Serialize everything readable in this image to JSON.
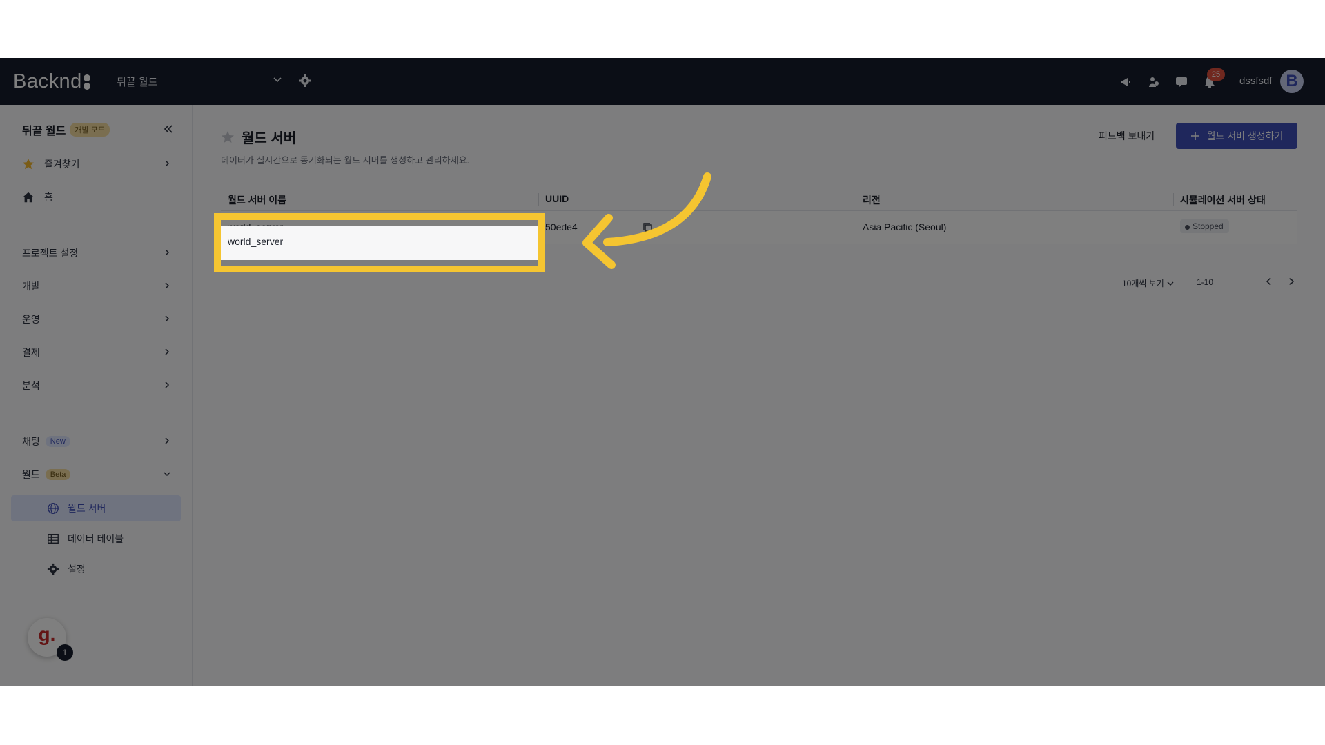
{
  "topbar": {
    "logo": "Backnd",
    "project": "뒤끝 월드",
    "notification_count": "25",
    "username": "dssfsdf",
    "avatar_letter": "B"
  },
  "sidebar": {
    "project_title": "뒤끝 월드",
    "mode_badge": "개발 모드",
    "favorites": "즐겨찾기",
    "home": "홈",
    "items": [
      {
        "label": "프로젝트 설정"
      },
      {
        "label": "개발"
      },
      {
        "label": "운영"
      },
      {
        "label": "결제"
      },
      {
        "label": "분석"
      }
    ],
    "chat": {
      "label": "채팅",
      "badge": "New"
    },
    "world": {
      "label": "월드",
      "badge": "Beta"
    },
    "world_children": [
      {
        "label": "월드 서버",
        "active": true
      },
      {
        "label": "데이터 테이블"
      },
      {
        "label": "설정"
      }
    ],
    "helper_letter": "g.",
    "helper_count": "1"
  },
  "main": {
    "title": "월드 서버",
    "description": "데이터가 실시간으로 동기화되는 월드 서버를 생성하고 관리하세요.",
    "feedback_label": "피드백 보내기",
    "create_label": "월드 서버 생성하기",
    "table": {
      "columns": [
        "월드 서버 이름",
        "UUID",
        "리전",
        "시뮬레이션 서버 상태"
      ],
      "rows": [
        {
          "name": "world_server",
          "uuid": "50ede4",
          "region": "Asia Pacific (Seoul)",
          "status": "Stopped"
        }
      ]
    },
    "pagination": {
      "per_page": "10개씩 보기",
      "range": "1-10"
    }
  },
  "colors": {
    "topbar_bg": "#161d2c",
    "primary": "#3f4fb8",
    "highlight": "#f5c531"
  }
}
